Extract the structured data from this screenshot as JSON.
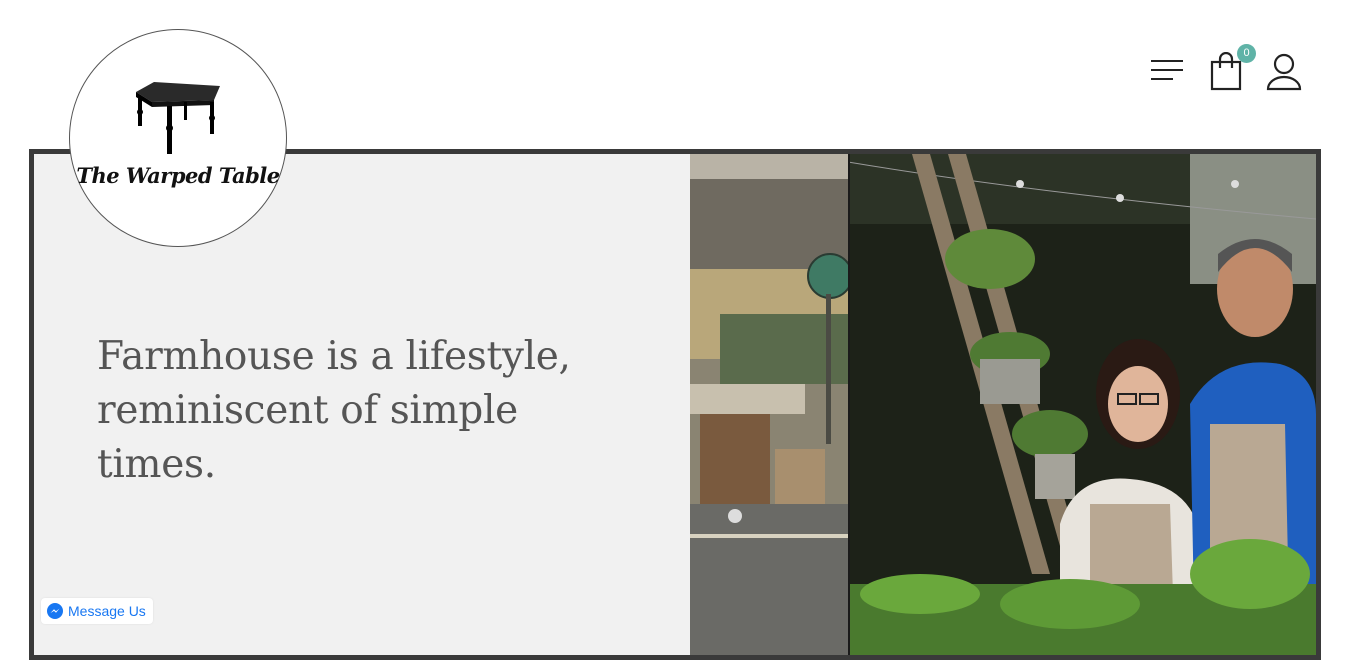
{
  "brand": {
    "name": "The Warped Table"
  },
  "header": {
    "menu_icon": "menu-icon",
    "cart_icon": "shopping-bag-icon",
    "cart_count": "0",
    "user_icon": "user-icon"
  },
  "hero": {
    "headline": "Farmhouse is a lifestyle, reminiscent of simple times.",
    "image_icon": "farmhouse-owners-photo"
  },
  "messenger": {
    "label": "Message Us",
    "icon": "messenger-icon"
  },
  "colors": {
    "badge": "#5fb3a7",
    "hero_bg": "#f1f1f1",
    "hero_border": "#3a3a3a",
    "messenger_blue": "#1877f2",
    "headline_text": "#555555"
  }
}
